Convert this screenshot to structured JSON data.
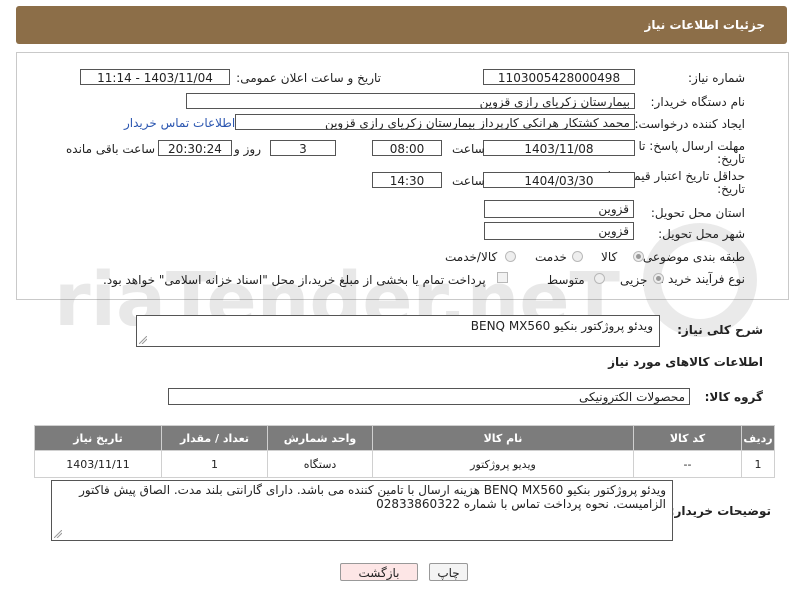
{
  "header": {
    "title": "جزئیات اطلاعات نیاز"
  },
  "form": {
    "need_number": {
      "label": "شماره نیاز:",
      "value": "1103005428000498"
    },
    "announce_datetime": {
      "label": "تاریخ و ساعت اعلان عمومی:",
      "value": "1403/11/04 - 11:14"
    },
    "buyer_org": {
      "label": "نام دستگاه خریدار:",
      "value": "بیمارستان زکریای رازی قزوین"
    },
    "requester": {
      "label": "ایجاد کننده درخواست:",
      "value": "محمد کشتکار هرانکی کارپرداز بیمارستان زکریای رازی قزوین",
      "contact_link": "اطلاعات تماس خریدار"
    },
    "response_deadline": {
      "label_line1": "مهلت ارسال پاسخ: تا",
      "label_line2": "تاریخ:",
      "date": "1403/11/08",
      "time_label": "ساعت",
      "time": "08:00",
      "days": "3",
      "days_label": "روز و",
      "remaining": "20:30:24",
      "remaining_label": "ساعت باقی مانده"
    },
    "price_validity": {
      "label_line1": "حداقل تاریخ اعتبار قیمت: تا",
      "label_line2": "تاریخ:",
      "date": "1404/03/30",
      "time_label": "ساعت",
      "time": "14:30"
    },
    "delivery_province": {
      "label": "استان محل تحویل:",
      "value": "قزوین"
    },
    "delivery_city": {
      "label": "شهر محل تحویل:",
      "value": "قزوین"
    },
    "category": {
      "label": "طبقه بندی موضوعی:",
      "options": [
        "کالا",
        "خدمت",
        "کالا/خدمت"
      ],
      "selected": "کالا"
    },
    "purchase_type": {
      "label": "نوع فرآیند خرید :",
      "options": [
        "جزیی",
        "متوسط"
      ],
      "selected": "جزیی",
      "payment_note": "پرداخت تمام یا بخشی از مبلغ خرید،از محل \"اسناد خزانه اسلامی\" خواهد بود."
    }
  },
  "summary": {
    "label": "شرح کلی نیاز:",
    "value": "ویدئو پروژکتور بنکیو BENQ MX560"
  },
  "goods_info_title": "اطلاعات کالاهای مورد نیاز",
  "goods_group": {
    "label": "گروه کالا:",
    "value": "محصولات الکترونیکی"
  },
  "table": {
    "headers": [
      "ردیف",
      "کد کالا",
      "نام کالا",
      "واحد شمارش",
      "تعداد / مقدار",
      "تاریخ نیاز"
    ],
    "rows": [
      [
        "1",
        "--",
        "ویدیو پروژکتور",
        "دستگاه",
        "1",
        "1403/11/11"
      ]
    ]
  },
  "buyer_notes": {
    "label": "توضیحات خریدار:",
    "value": "ویدئو پروژکتور بنکیو BENQ MX560 هزینه ارسال با تامین کننده می باشد. دارای گارانتی بلند مدت. الصاق پیش فاکتور الزامیست. نحوه پرداخت تماس با شماره 02833860322"
  },
  "buttons": {
    "print": "چاپ",
    "back": "بازگشت"
  },
  "watermark": "AriaTender.neT",
  "colors": {
    "header_bg": "#8c6e48",
    "table_header_bg": "#7c7c7c",
    "link": "#2b56b0",
    "back_button_bg": "#fde6e6"
  }
}
